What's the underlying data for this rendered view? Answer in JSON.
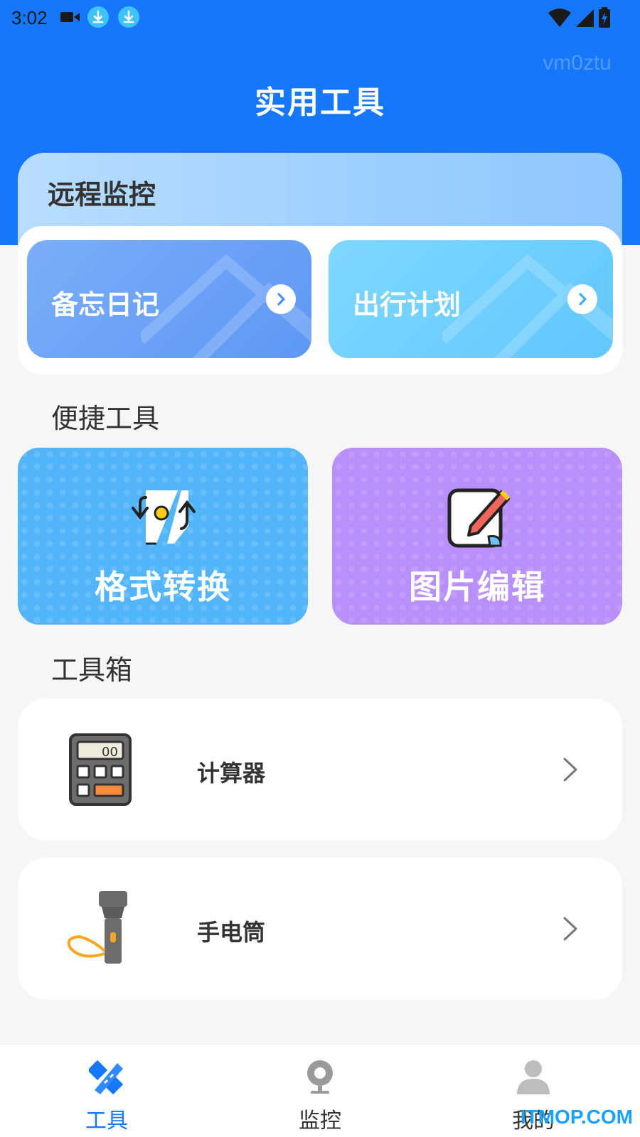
{
  "status_bar": {
    "time": "3:02"
  },
  "watermark": "vm0ztu",
  "header": {
    "title": "实用工具"
  },
  "remote": {
    "title": "远程监控",
    "features": [
      {
        "label": "备忘日记",
        "icon": "chevron-right-circle-icon"
      },
      {
        "label": "出行计划",
        "icon": "chevron-right-circle-icon"
      }
    ]
  },
  "quick_tools": {
    "title": "便捷工具",
    "items": [
      {
        "label": "格式转换",
        "icon": "convert-icon",
        "color": "#52b5f9"
      },
      {
        "label": "图片编辑",
        "icon": "edit-image-icon",
        "color": "#b88ffb"
      }
    ]
  },
  "toolbox": {
    "title": "工具箱",
    "items": [
      {
        "label": "计算器",
        "icon": "calculator-icon",
        "display": "00"
      },
      {
        "label": "手电筒",
        "icon": "flashlight-icon"
      }
    ]
  },
  "bottom_nav": {
    "items": [
      {
        "label": "工具",
        "icon": "ruler-pencil-icon",
        "active": true
      },
      {
        "label": "监控",
        "icon": "webcam-icon",
        "active": false
      },
      {
        "label": "我的",
        "icon": "user-icon",
        "active": false
      }
    ]
  },
  "corner_mark": "ITMOP.COM",
  "colors": {
    "primary": "#1677fb",
    "convert": "#52b5f9",
    "image_edit": "#b88ffb"
  }
}
